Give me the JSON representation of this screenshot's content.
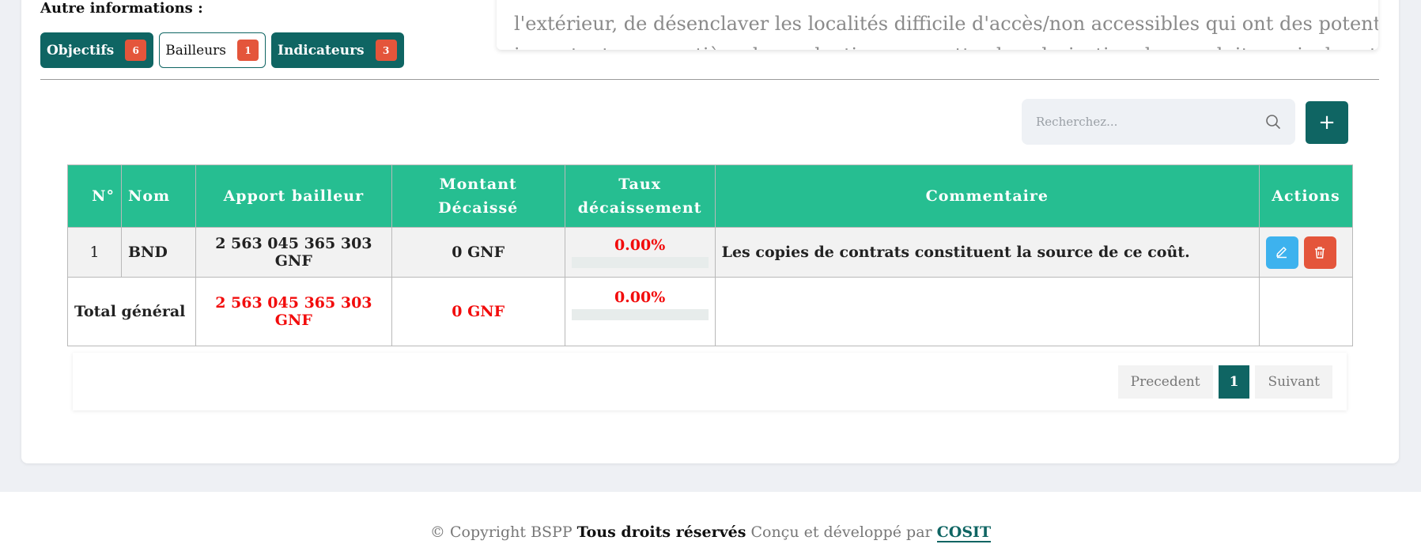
{
  "section": {
    "other_info_label": "Autre informations :"
  },
  "tabs": [
    {
      "label": "Objectifs",
      "count": "6"
    },
    {
      "label": "Bailleurs",
      "count": "1"
    },
    {
      "label": "Indicateurs",
      "count": "3"
    }
  ],
  "description": {
    "line1": "l'extérieur, de désenclaver les localités difficile d'accès/non accessibles qui ont des potentialités",
    "line2": "importantes en matière de production, permettre la valorisation des produits agricoles et"
  },
  "search": {
    "placeholder": "Recherchez..."
  },
  "add_button": {
    "label": "+"
  },
  "table": {
    "headers": {
      "num": "N°",
      "nom": "Nom",
      "apport": "Apport bailleur",
      "montant": "Montant Décaissé",
      "taux_line1": "Taux",
      "taux_line2": "décaissement",
      "commentaire": "Commentaire",
      "actions": "Actions"
    },
    "rows": [
      {
        "num": "1",
        "nom": "BND",
        "apport": "2 563 045 365 303 GNF",
        "montant": "0 GNF",
        "taux": "0.00%",
        "taux_fraction": 0,
        "commentaire": "Les copies de contrats constituent la source de ce coût."
      }
    ],
    "total": {
      "label": "Total général",
      "apport": "2 563 045 365 303 GNF",
      "montant": "0 GNF",
      "taux": "0.00%",
      "taux_fraction": 0
    }
  },
  "pagination": {
    "prev": "Precedent",
    "current": "1",
    "next": "Suivant"
  },
  "footer": {
    "prefix": "© Copyright BSPP",
    "rights": "Tous droits réservés",
    "middle": "Conçu et développé par",
    "brand": "COSIT"
  },
  "colors": {
    "teal": "#0f6563",
    "header_green": "#26be91",
    "badge_red": "#e4553b",
    "edit_blue": "#3db2ee",
    "value_red": "#f20c0c"
  },
  "icons": {
    "search": "search-icon",
    "edit": "pencil-icon",
    "delete": "trash-icon"
  }
}
